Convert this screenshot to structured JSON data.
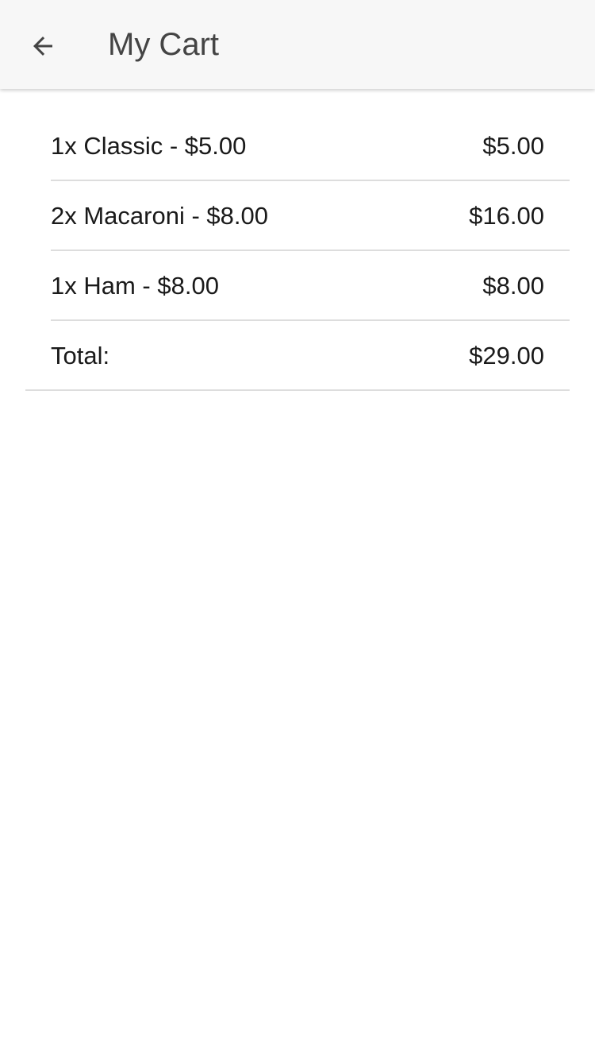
{
  "header": {
    "title": "My Cart",
    "back_icon": "arrow-left-icon"
  },
  "cart": {
    "items": [
      {
        "label": "1x Classic - $5.00",
        "subtotal": "$5.00"
      },
      {
        "label": "2x Macaroni - $8.00",
        "subtotal": "$16.00"
      },
      {
        "label": "1x Ham - $8.00",
        "subtotal": "$8.00"
      }
    ],
    "total_label": "Total:",
    "total_value": "$29.00"
  },
  "colors": {
    "header_background": "#f7f7f7",
    "title_text": "#444444",
    "body_text": "#1a1a1a",
    "divider": "#dddddd"
  }
}
